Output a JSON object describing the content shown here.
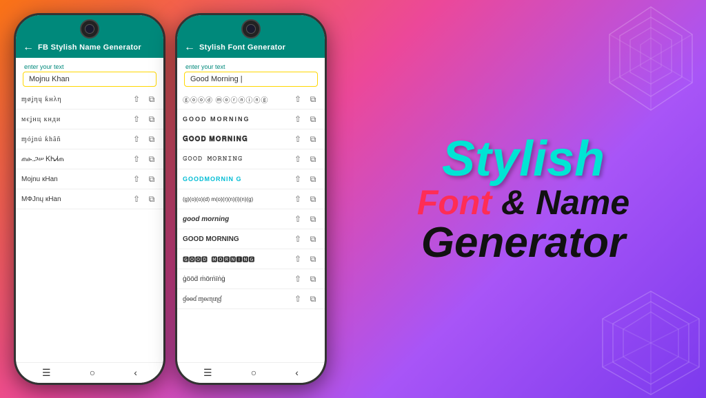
{
  "app1": {
    "title": "FB Stylish Name Generator",
    "input_label": "enter your text",
    "input_value": "Mojnu Khan",
    "font_items": [
      {
        "text": "ɱøʝηų ƙнλη",
        "style": "font-circular"
      },
      {
        "text": "мєʝнц кнди",
        "style": "font-circular"
      },
      {
        "text": "ɱóʝnú ƙĥâñ",
        "style": "font-circular"
      },
      {
        "text": "ጠፁ.ጋሠ ᏦᏂᏗጠ",
        "style": "font-circular"
      },
      {
        "text": "Mojnu кHan",
        "style": "font-caps-small"
      },
      {
        "text": "MФJnų кHan",
        "style": "font-caps-small"
      }
    ],
    "nav": [
      "☰",
      "○",
      "‹"
    ]
  },
  "app2": {
    "title": "Stylish Font Generator",
    "input_label": "enter your text",
    "input_value": "Good Morning",
    "font_items": [
      {
        "text": "ⓖⓞⓞⓓ ⓜⓞⓡⓝⓘⓝⓖ",
        "style": "font-circular"
      },
      {
        "text": "GOOD MORNING",
        "style": "font-outlined"
      },
      {
        "text": "𝐆𝐎𝐎𝐃 𝐌𝐎𝐑𝐍𝐈𝐍𝐆",
        "style": "font-bold-serif"
      },
      {
        "text": "𝙶𝙾𝙾𝙳 𝙼𝙾𝚁𝙽𝙸𝙽𝙶",
        "style": "font-block"
      },
      {
        "text": "GOODMORNIN G",
        "style": "font-teal"
      },
      {
        "text": "(g)(o)(o)(d) m(o)(r)(n)(i)(n)(g)",
        "style": "font-paren"
      },
      {
        "text": "good morning",
        "style": "font-italic-script"
      },
      {
        "text": "GOOD MORNING",
        "style": "font-caps-small"
      },
      {
        "text": "🅶🅾🅾🅳 🅼🅾🆁🅽🅸🅽🅶",
        "style": "font-square"
      },
      {
        "text": "ġööḋ ṁörṅïṅġ",
        "style": "font-dots"
      },
      {
        "text": "ɠɵɵɗ ɱɵɾɳɩɳɠ",
        "style": "font-script2"
      }
    ],
    "nav": [
      "☰",
      "○",
      "‹"
    ]
  },
  "brand": {
    "line1": "Stylish",
    "line2_font": "Font",
    "line2_rest": " & Name",
    "line3": "Generator"
  },
  "icons": {
    "share": "⇧",
    "copy": "⧉",
    "back": "←"
  }
}
